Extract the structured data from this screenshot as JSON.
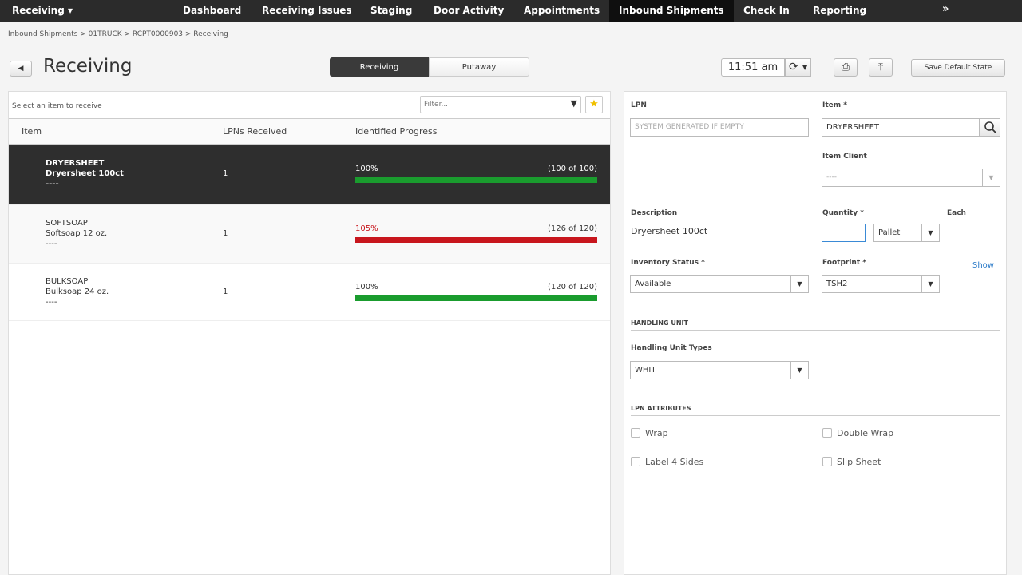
{
  "nav": {
    "app_menu": "Receiving ▾",
    "tabs": [
      "Dashboard",
      "Receiving Issues",
      "Staging",
      "Door Activity",
      "Appointments",
      "Inbound Shipments",
      "Check In",
      "Reporting"
    ],
    "more": "»"
  },
  "breadcrumb": "Inbound Shipments > 01TRUCK > RCPT0000903 > Receiving",
  "page": {
    "title": "Receiving",
    "segments": [
      "Receiving",
      "Putaway"
    ],
    "time": "11:51 am",
    "save_default": "Save Default State"
  },
  "list": {
    "hint": "Select an item to receive",
    "filter_placeholder": "Filter...",
    "columns": [
      "Item",
      "LPNs Received",
      "Identified Progress"
    ],
    "rows": [
      {
        "code": "DRYERSHEET",
        "desc": "Dryersheet 100ct",
        "extra": "----",
        "lpns": "1",
        "pct": "100%",
        "count": "(100 of 100)",
        "progress": 1.0,
        "color": "#1a9c2e"
      },
      {
        "code": "SOFTSOAP",
        "desc": "Softsoap 12 oz.",
        "extra": "----",
        "lpns": "1",
        "pct": "105%",
        "count": "(126 of 120)",
        "progress": 1.0,
        "color": "#c8161d"
      },
      {
        "code": "BULKSOAP",
        "desc": "Bulksoap 24 oz.",
        "extra": "----",
        "lpns": "1",
        "pct": "100%",
        "count": "(120 of 120)",
        "progress": 1.0,
        "color": "#1a9c2e"
      }
    ]
  },
  "form": {
    "lpn_label": "LPN",
    "lpn_placeholder": "SYSTEM GENERATED IF EMPTY",
    "item_label": "Item *",
    "item_value": "DRYERSHEET",
    "item_client_label": "Item Client",
    "item_client_value": "----",
    "description_label": "Description",
    "description_value": "Dryersheet 100ct",
    "quantity_label": "Quantity *",
    "quantity_uom": "Pallet",
    "each_label": "Each",
    "inventory_status_label": "Inventory Status *",
    "inventory_status_value": "Available",
    "footprint_label": "Footprint *",
    "footprint_value": "TSH2",
    "show_link": "Show",
    "handling_unit_section": "HANDLING UNIT",
    "handling_unit_types_label": "Handling Unit Types",
    "handling_unit_types_value": "WHIT",
    "lpn_attributes_section": "LPN ATTRIBUTES",
    "attributes": [
      "Wrap",
      "Double Wrap",
      "Label 4 Sides",
      "Slip Sheet"
    ]
  }
}
